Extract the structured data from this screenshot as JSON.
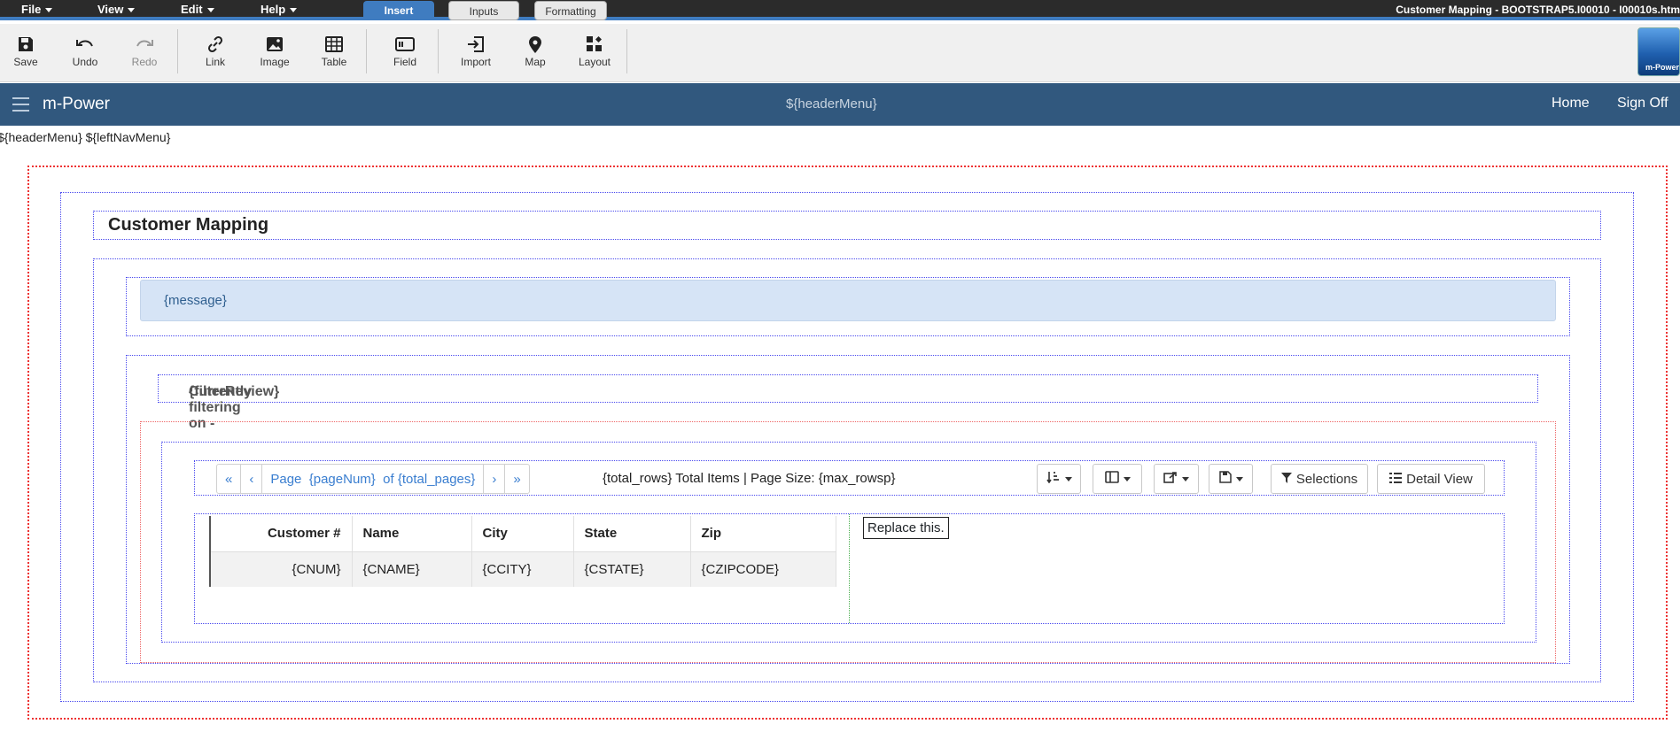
{
  "menubar": {
    "menus": [
      "File",
      "View",
      "Edit",
      "Help"
    ],
    "ribbon_tabs": [
      "Insert",
      "Inputs",
      "Formatting"
    ],
    "window_title": "Customer Mapping - BOOTSTRAP5.I00010 - I00010s.htm"
  },
  "toolbar": {
    "save": "Save",
    "undo": "Undo",
    "redo": "Redo",
    "link": "Link",
    "image": "Image",
    "table": "Table",
    "field": "Field",
    "import": "Import",
    "map": "Map",
    "layout": "Layout",
    "logo_text": "m-Power"
  },
  "navbar": {
    "brand": "m-Power",
    "center": "${headerMenu}",
    "home": "Home",
    "sign_off": "Sign Off"
  },
  "template_vars": "${headerMenu} ${leftNavMenu}",
  "page": {
    "title": "Customer Mapping",
    "message": "{message}",
    "filter_label": "Currently filtering on -",
    "filter_value": "{filterReview}"
  },
  "pager": {
    "first": "«",
    "prev": "‹",
    "page_label": "Page",
    "page_num": "{pageNum}",
    "of_label": "of",
    "total_pages": "{total_pages}",
    "next": "›",
    "last": "»",
    "info": "{total_rows}  Total Items | Page Size:  {max_rowsp}",
    "selections": "Selections",
    "detail_view": "Detail View"
  },
  "table": {
    "headers": [
      "Customer #",
      "Name",
      "City",
      "State",
      "Zip"
    ],
    "row": [
      "{CNUM}",
      "{CNAME}",
      "{CCITY}",
      "{CSTATE}",
      "{CZIPCODE}"
    ]
  },
  "replace_text": "Replace this.",
  "colors": {
    "menubar": "#2b2b2b",
    "accent": "#3f7cc0",
    "navbar": "#31587e",
    "message_bg": "#d6e4f6",
    "link_blue": "#3a7ed0"
  }
}
